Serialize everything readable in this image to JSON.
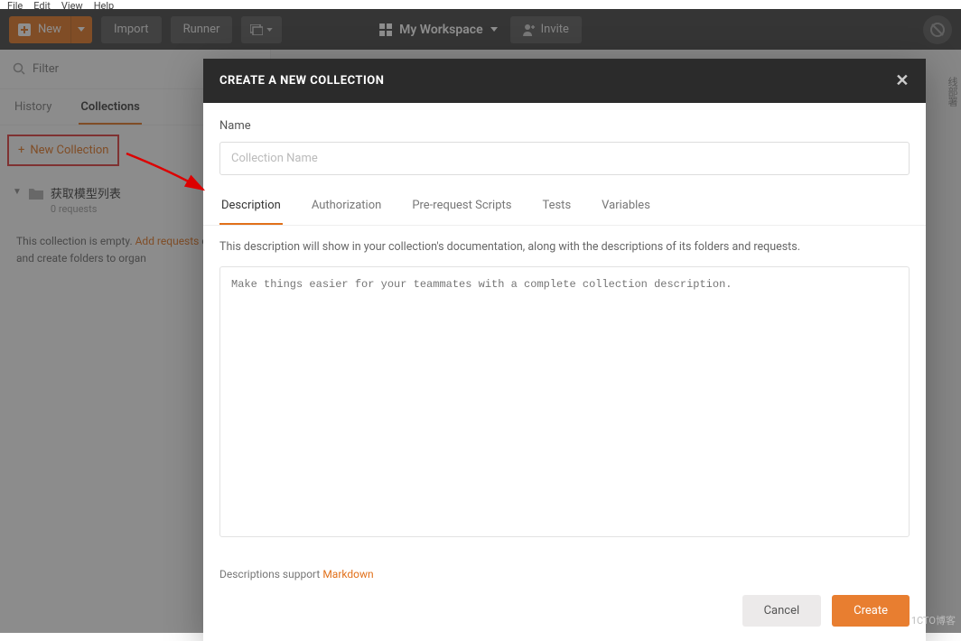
{
  "menubar": {
    "file": "File",
    "edit": "Edit",
    "view": "View",
    "help": "Help"
  },
  "header": {
    "new_label": "New",
    "import_label": "Import",
    "runner_label": "Runner",
    "workspace_label": "My Workspace",
    "invite_label": "Invite"
  },
  "sidebar": {
    "filter_placeholder": "Filter",
    "tabs": {
      "history": "History",
      "collections": "Collections"
    },
    "new_collection": "New Collection",
    "collection": {
      "name": "获取模型列表",
      "sub": "0 requests"
    },
    "empty_pre": "This collection is empty. ",
    "empty_link": "Add requests",
    "empty_post": " collection and create folders to organ"
  },
  "side_label": "线部署",
  "modal": {
    "title": "CREATE A NEW COLLECTION",
    "name_label": "Name",
    "name_placeholder": "Collection Name",
    "tabs": {
      "description": "Description",
      "authorization": "Authorization",
      "prerequest": "Pre-request Scripts",
      "tests": "Tests",
      "variables": "Variables"
    },
    "desc_hint": "This description will show in your collection's documentation, along with the descriptions of its folders and requests.",
    "desc_placeholder": "Make things easier for your teammates with a complete collection description.",
    "md_pre": "Descriptions support ",
    "md_link": "Markdown",
    "cancel": "Cancel",
    "create": "Create"
  },
  "watermark": "1CTO博客"
}
